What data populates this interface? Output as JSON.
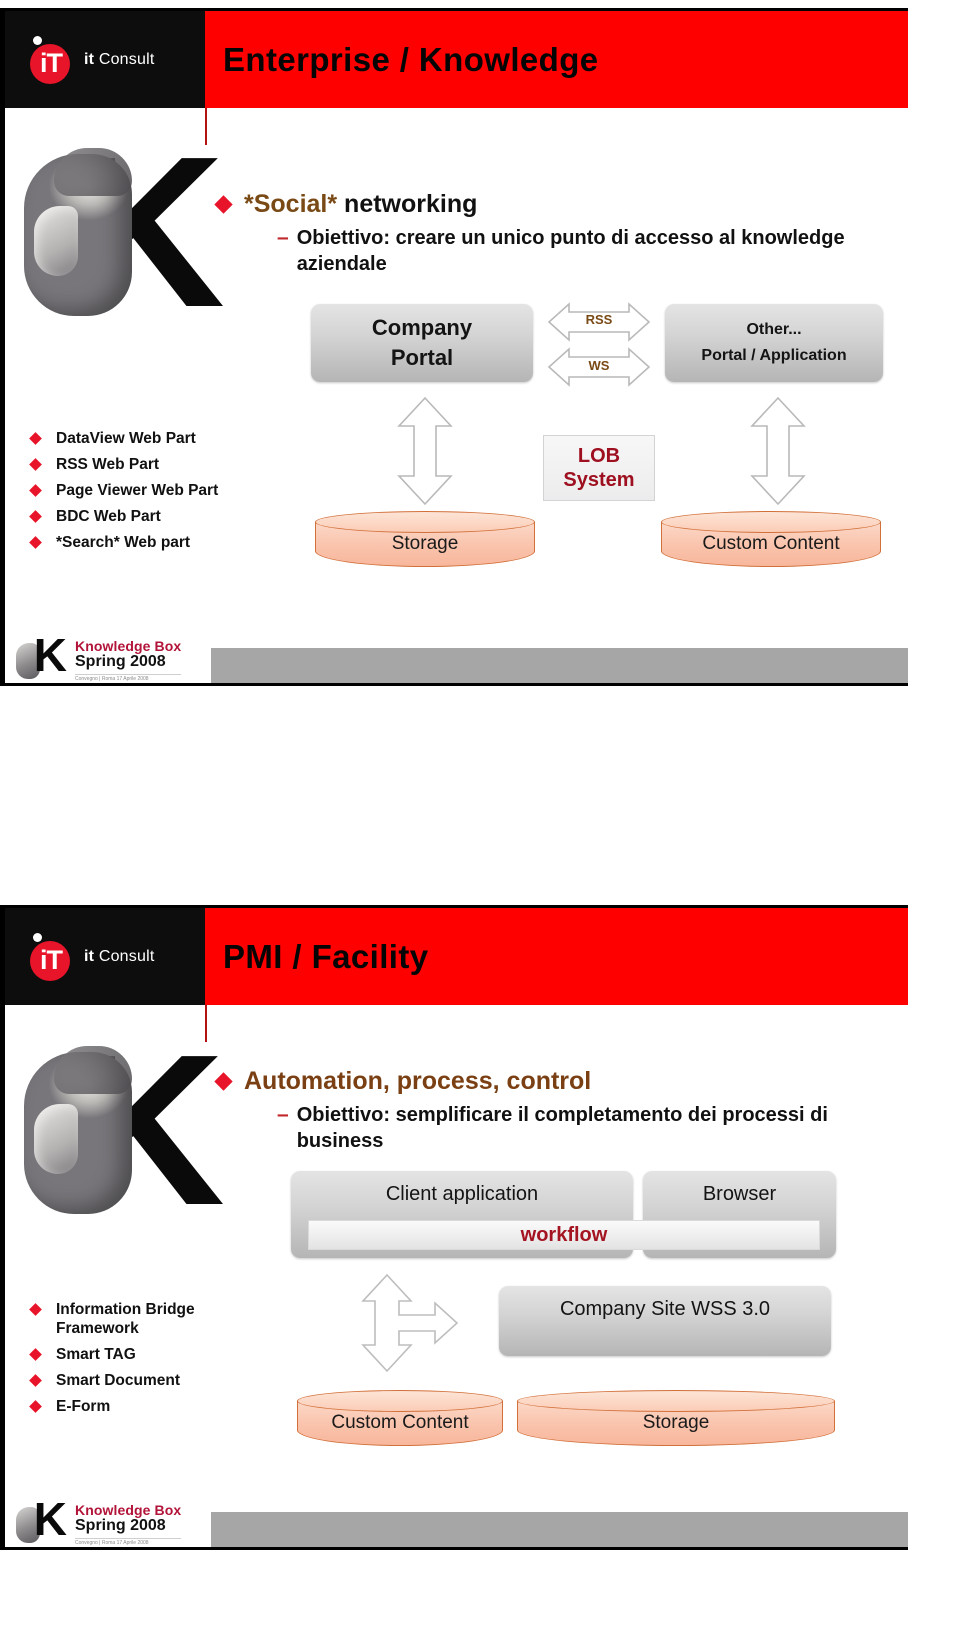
{
  "brand": {
    "logo_mark": "it-logo-icon",
    "logo_name_bold": "it",
    "logo_name_rest": " Consult"
  },
  "footer": {
    "line1": "Knowledge Box",
    "line2": "Spring 2008",
    "line3": "Convegno | Roma 17 Aprile 2008"
  },
  "colors": {
    "header_red": "#fe0000",
    "bullet_red": "#e8142a",
    "accent_brown": "#7a4a16",
    "dark_red": "#9e1020",
    "cylinder_fill": "#fac3ac",
    "footer_bar_gray": "#a6a6a6"
  },
  "slide1": {
    "title": "Enterprise / Knowledge",
    "bullet1_accent": "*Social*",
    "bullet1_rest": " networking",
    "sub1": "Obiettivo: creare un unico punto di accesso al knowledge aziendale",
    "side_items": [
      "DataView Web Part",
      "RSS Web Part",
      "Page Viewer Web Part",
      "BDC Web Part",
      "*Search* Web part"
    ],
    "diagram": {
      "company_portal_l1": "Company",
      "company_portal_l2": "Portal",
      "other_l1": "Other...",
      "other_l2": "Portal / Application",
      "arrow_rss": "RSS",
      "arrow_ws": "WS",
      "lob_l1": "LOB",
      "lob_l2": "System",
      "storage": "Storage",
      "custom_content": "Custom Content"
    }
  },
  "slide2": {
    "title": "PMI / Facility",
    "bullet1": "Automation, process, control",
    "sub1": "Obiettivo: semplificare il completamento dei processi di business",
    "side_items": [
      "Information Bridge Framework",
      "Smart TAG",
      "Smart Document",
      "E-Form"
    ],
    "diagram": {
      "client_application": "Client application",
      "browser": "Browser",
      "workflow": "workflow",
      "company_site": "Company Site WSS 3.0",
      "custom_content": "Custom Content",
      "storage": "Storage"
    }
  }
}
